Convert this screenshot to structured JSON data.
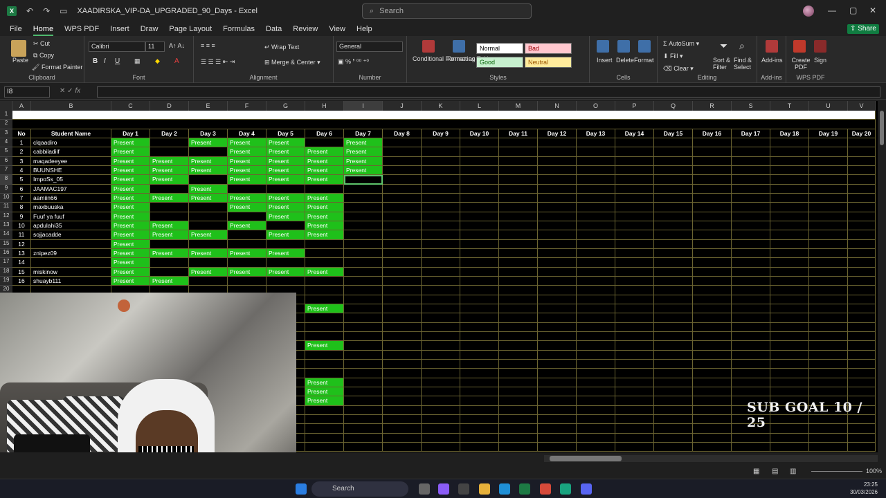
{
  "app": {
    "title": "XAADIRSKA_VIP-DA_UPGRADED_90_Days - Excel",
    "search_placeholder": "Search",
    "share_label": "Share",
    "brand_color": "#107c41"
  },
  "menu": {
    "tabs": [
      "File",
      "Home",
      "WPS PDF",
      "Insert",
      "Draw",
      "Page Layout",
      "Formulas",
      "Data",
      "Review",
      "View",
      "Help"
    ],
    "active": "Home"
  },
  "ribbon": {
    "clipboard": {
      "paste": "Paste",
      "cut": "Cut",
      "copy": "Copy",
      "format_painter": "Format Painter",
      "label": "Clipboard"
    },
    "font": {
      "name": "Calibri",
      "size": "11",
      "label": "Font"
    },
    "alignment": {
      "wrap": "Wrap Text",
      "merge": "Merge & Center",
      "label": "Alignment"
    },
    "number": {
      "format": "General",
      "label": "Number"
    },
    "styles": {
      "conditional": "Conditional Formatting",
      "format_as": "Format as Table",
      "normal": "Normal",
      "bad": "Bad",
      "good": "Good",
      "neutral": "Neutral",
      "label": "Styles"
    },
    "cells": {
      "insert": "Insert",
      "delete": "Delete",
      "format": "Format",
      "label": "Cells"
    },
    "editing": {
      "autosum": "AutoSum",
      "fill": "Fill",
      "clear": "Clear",
      "sort": "Sort & Filter",
      "find": "Find & Select",
      "label": "Editing"
    },
    "addins": {
      "addins": "Add-ins",
      "label": "Add-ins"
    },
    "wps": {
      "create": "Create PDF",
      "sign": "Sign",
      "label": "WPS PDF"
    }
  },
  "formula_bar": {
    "name_box": "I8",
    "fx": "fx",
    "value": ""
  },
  "sheet": {
    "columns": [
      "A",
      "B",
      "C",
      "D",
      "E",
      "F",
      "G",
      "H",
      "I",
      "J",
      "K",
      "L",
      "M",
      "N",
      "O",
      "P",
      "Q",
      "R",
      "S",
      "T",
      "U",
      "V"
    ],
    "header_row": [
      "No",
      "Student Name",
      "Day 1",
      "Day 2",
      "Day 3",
      "Day 4",
      "Day 5",
      "Day 6",
      "Day 7",
      "Day 8",
      "Day 9",
      "Day 10",
      "Day 11",
      "Day 12",
      "Day 13",
      "Day 14",
      "Day 15",
      "Day 16",
      "Day 17",
      "Day 18",
      "Day 19",
      "Day 20"
    ],
    "present_label": "Present",
    "students": [
      {
        "no": "1",
        "name": "clqaadiro",
        "days": [
          1,
          0,
          1,
          1,
          1,
          0,
          1
        ]
      },
      {
        "no": "2",
        "name": "cabbiladiif",
        "days": [
          1,
          0,
          0,
          1,
          1,
          1,
          1
        ]
      },
      {
        "no": "3",
        "name": "maqadeeyee",
        "days": [
          1,
          1,
          1,
          1,
          1,
          1,
          1
        ]
      },
      {
        "no": "4",
        "name": "BUUNSHE",
        "days": [
          1,
          1,
          1,
          1,
          1,
          1,
          1
        ]
      },
      {
        "no": "5",
        "name": "ImpoSs_05",
        "days": [
          1,
          1,
          0,
          1,
          1,
          1,
          0
        ]
      },
      {
        "no": "6",
        "name": "JAAMAC197",
        "days": [
          1,
          0,
          1,
          0,
          0,
          0,
          0
        ]
      },
      {
        "no": "7",
        "name": "aamiin66",
        "days": [
          1,
          1,
          1,
          1,
          1,
          1,
          0
        ]
      },
      {
        "no": "8",
        "name": "maxbuuska",
        "days": [
          1,
          0,
          0,
          1,
          1,
          1,
          0
        ]
      },
      {
        "no": "9",
        "name": "Fuuf ya fuuf",
        "days": [
          1,
          0,
          0,
          0,
          1,
          1,
          0
        ]
      },
      {
        "no": "10",
        "name": "apdulahi35",
        "days": [
          1,
          1,
          0,
          1,
          0,
          1,
          0
        ]
      },
      {
        "no": "11",
        "name": "sojjacadde",
        "days": [
          1,
          1,
          1,
          0,
          1,
          1,
          0
        ]
      },
      {
        "no": "12",
        "name": "",
        "days": [
          1,
          0,
          0,
          0,
          0,
          0,
          0
        ]
      },
      {
        "no": "13",
        "name": "znipez09",
        "days": [
          1,
          1,
          1,
          1,
          1,
          0,
          0
        ]
      },
      {
        "no": "14",
        "name": "",
        "days": [
          1,
          0,
          0,
          0,
          0,
          0,
          0
        ]
      },
      {
        "no": "15",
        "name": "miskinow",
        "days": [
          1,
          0,
          1,
          1,
          1,
          1,
          0
        ]
      },
      {
        "no": "16",
        "name": "shuayb111",
        "days": [
          1,
          1,
          0,
          0,
          0,
          0,
          0
        ]
      }
    ],
    "extra_present_rows": [
      22,
      26,
      30,
      31,
      32
    ],
    "sub_goal": "SUB GOAL 10 / 25"
  },
  "status": {
    "zoom": "100%"
  },
  "taskbar": {
    "search": "Search",
    "time": "23:25",
    "date": "30/03/2026"
  }
}
